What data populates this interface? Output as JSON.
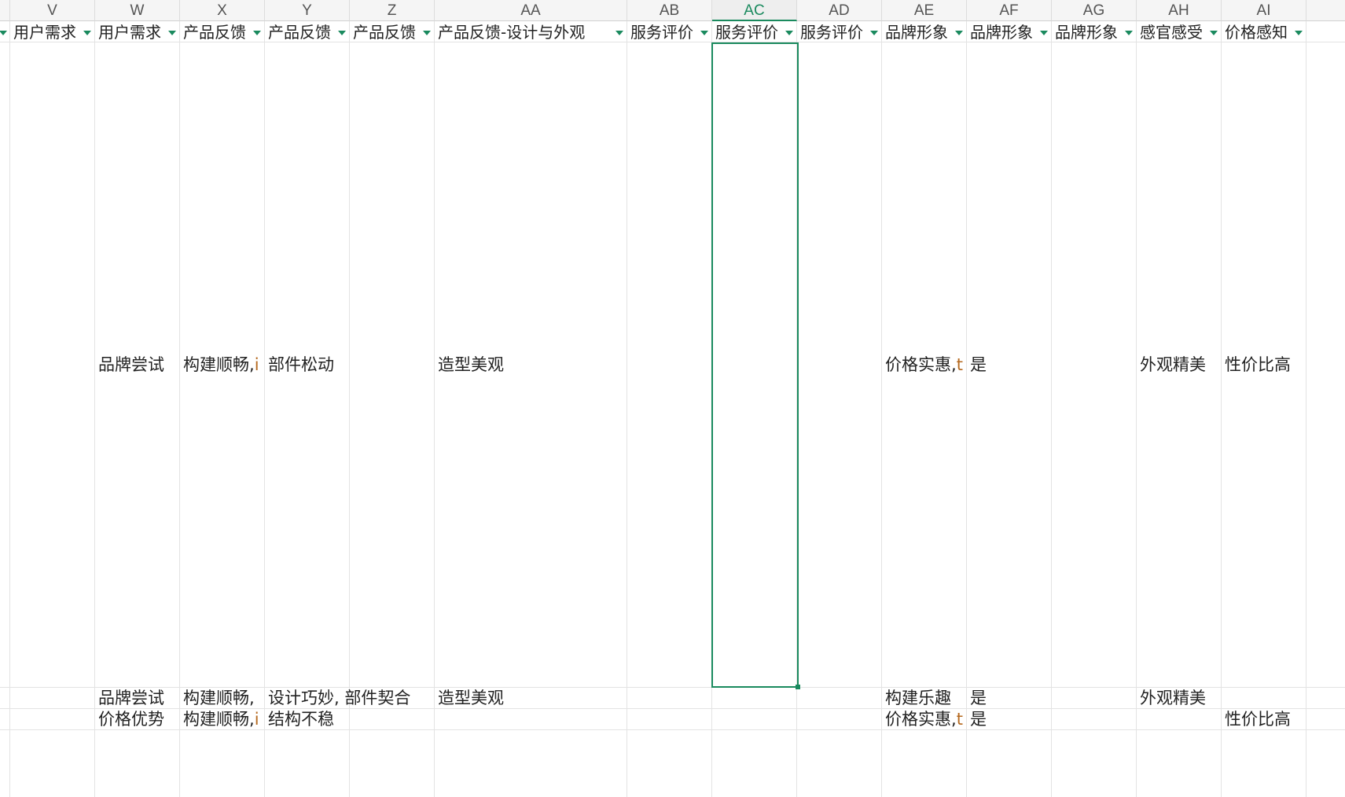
{
  "spreadsheet": {
    "columns": [
      {
        "letter": "V",
        "header": "用户需求"
      },
      {
        "letter": "W",
        "header": "用户需求"
      },
      {
        "letter": "X",
        "header": "产品反馈"
      },
      {
        "letter": "Y",
        "header": "产品反馈"
      },
      {
        "letter": "Z",
        "header": "产品反馈"
      },
      {
        "letter": "AA",
        "header": "产品反馈-设计与外观"
      },
      {
        "letter": "AB",
        "header": "服务评价"
      },
      {
        "letter": "AC",
        "header": "服务评价"
      },
      {
        "letter": "AD",
        "header": "服务评价"
      },
      {
        "letter": "AE",
        "header": "品牌形象"
      },
      {
        "letter": "AF",
        "header": "品牌形象"
      },
      {
        "letter": "AG",
        "header": "品牌形象"
      },
      {
        "letter": "AH",
        "header": "感官感受"
      },
      {
        "letter": "AI",
        "header": "价格感知"
      }
    ],
    "active_column": "AC",
    "rows": [
      {
        "W": "品牌尝试",
        "X": "构建顺畅,",
        "X_overflow": "i",
        "Y": "部件松动",
        "AA": "造型美观",
        "AE": "价格实惠,",
        "AE_overflow": "t",
        "AF": "是",
        "AH": "外观精美",
        "AI": "性价比高"
      },
      {
        "W": "品牌尝试",
        "X": "构建顺畅,",
        "Y": "设计巧妙, 部件契合",
        "AA": "造型美观",
        "AE": "构建乐趣",
        "AF": "是",
        "AH": "外观精美"
      },
      {
        "W": "价格优势",
        "X": "构建顺畅,",
        "X_overflow": "i",
        "Y": "结构不稳",
        "AE": "价格实惠,",
        "AE_overflow": "t",
        "AF": "是",
        "AI": "性价比高"
      }
    ]
  },
  "theme": {
    "accent": "#1a8a5e",
    "overflow_hint": "#b5691f",
    "gridline": "#e3e3e3",
    "header_bg": "#f5f5f5"
  },
  "icons": {
    "filter": "filter-dropdown-icon"
  }
}
